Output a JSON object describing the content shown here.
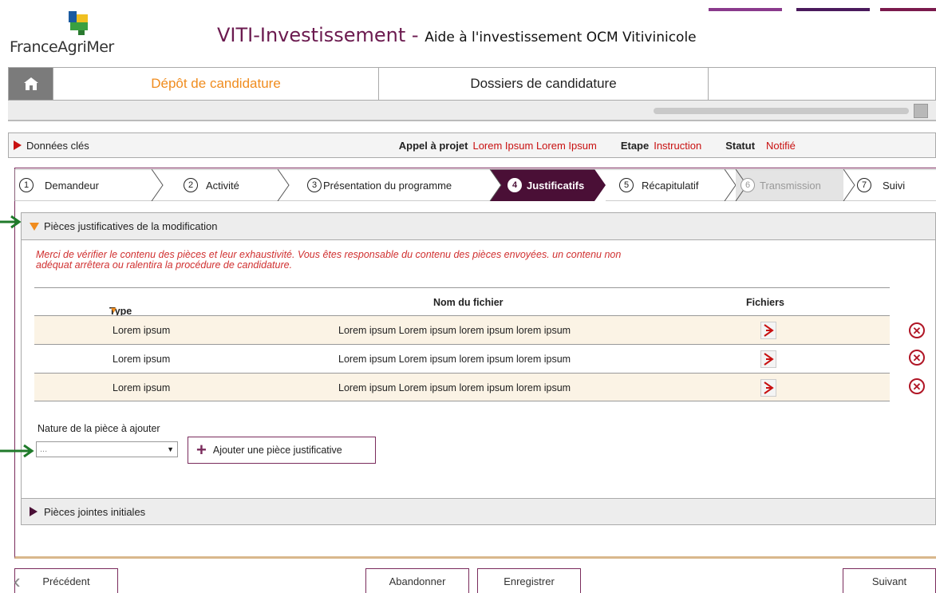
{
  "header": {
    "logo_text": "FranceAgriMer",
    "title_main": "VITI-Investissement",
    "title_separator": " - ",
    "title_sub": "Aide à l'investissement OCM Vitivinicole",
    "deco_colors": [
      "#8a3a8c",
      "#4a1a5c",
      "#7a1a4c"
    ]
  },
  "topnav": {
    "home_icon": "home-icon",
    "tabs": [
      {
        "label": "Dépôt de candidature",
        "active": true
      },
      {
        "label": "Dossiers de candidature",
        "active": false
      }
    ]
  },
  "keybar": {
    "title": "Données clés",
    "appel_label": "Appel à projet",
    "appel_value": "Lorem Ipsum Lorem Ipsum",
    "etape_label": "Etape",
    "etape_value": "Instruction",
    "statut_label": "Statut",
    "statut_value": "Notifié"
  },
  "stepper": {
    "steps": [
      {
        "num": "1",
        "label": "Demandeur",
        "state": "done"
      },
      {
        "num": "2",
        "label": "Activité",
        "state": "done"
      },
      {
        "num": "3",
        "label": "Présentation du programme",
        "state": "done"
      },
      {
        "num": "4",
        "label": "Justificatifs",
        "state": "active"
      },
      {
        "num": "5",
        "label": "Récapitulatif",
        "state": "done"
      },
      {
        "num": "6",
        "label": "Transmission",
        "state": "disabled"
      },
      {
        "num": "7",
        "label": "Suivi",
        "state": "done"
      }
    ]
  },
  "section": {
    "title": "Pièces justificatives de la modification",
    "warning_line1": "Merci de vérifier le contenu des pièces et leur exhaustivité. Vous êtes responsable du contenu des pièces envoyées. un contenu non",
    "warning_line2": "adéquat arrêtera ou ralentira la procédure de candidature.",
    "columns": {
      "type": "Type de pièce",
      "nom": "Nom du fichier",
      "fichiers": "Fichiers"
    },
    "rows": [
      {
        "type": "Lorem ipsum",
        "nom": "Lorem ipsum Lorem ipsum  lorem ipsum lorem ipsum"
      },
      {
        "type": "Lorem ipsum",
        "nom": "Lorem ipsum Lorem ipsum  lorem ipsum lorem ipsum"
      },
      {
        "type": "Lorem ipsum",
        "nom": "Lorem ipsum Lorem ipsum  lorem ipsum lorem ipsum"
      }
    ],
    "nature_label": "Nature de la pièce à ajouter",
    "select_value": "...",
    "add_button": "Ajouter une pièce justificative"
  },
  "section2": {
    "title": "Pièces jointes initiales"
  },
  "footer": {
    "prev": "Précédent",
    "abandon": "Abandonner",
    "save": "Enregistrer",
    "next": "Suivant"
  }
}
